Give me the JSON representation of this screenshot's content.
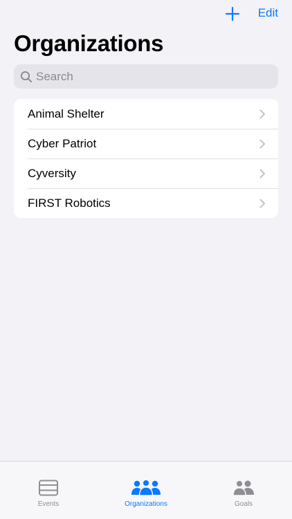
{
  "nav": {
    "add_icon": "plus-icon",
    "edit_label": "Edit",
    "accent_color": "#0a7aff"
  },
  "page": {
    "title": "Organizations"
  },
  "search": {
    "placeholder": "Search",
    "value": "",
    "icon": "magnifying-glass-icon"
  },
  "organizations": [
    {
      "label": "Animal Shelter"
    },
    {
      "label": "Cyber Patriot"
    },
    {
      "label": "Cyversity"
    },
    {
      "label": "FIRST Robotics"
    }
  ],
  "tab_bar": {
    "tabs": [
      {
        "label": "Events",
        "icon": "events-icon",
        "active": false
      },
      {
        "label": "Organizations",
        "icon": "people-three-icon",
        "active": true
      },
      {
        "label": "Goals",
        "icon": "people-two-icon",
        "active": false
      }
    ],
    "active_color": "#0a7aff",
    "inactive_color": "#8e8e93"
  }
}
